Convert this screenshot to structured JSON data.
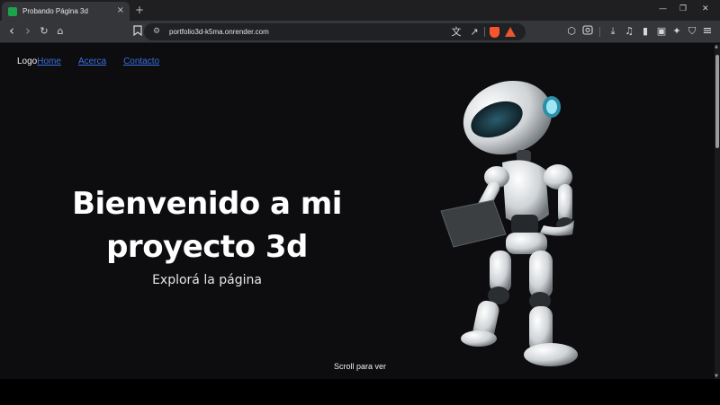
{
  "browser": {
    "tab_title": "Probando Página 3d",
    "tab_close": "×",
    "new_tab": "+",
    "url": "portfolio3d-k5ma.onrender.com",
    "window_controls": {
      "minimize": "—",
      "restore": "❐",
      "close": "✕"
    }
  },
  "toolbar_icons": {
    "back": "‹",
    "forward": "›",
    "reload": "↻",
    "home": "⌂",
    "translate": "文",
    "share": "↗",
    "extensions": "⬡",
    "download": "⤓",
    "media": "♫",
    "sidebar": "▮",
    "wallet": "▣",
    "leo": "✦",
    "vpn": "⛉",
    "menu": "≡"
  },
  "nav": {
    "logo": "Logo",
    "links": [
      "Home",
      "Acerca",
      "Contacto"
    ]
  },
  "hero": {
    "title_line1": "Bienvenido a mi",
    "title_line2": "proyecto 3d",
    "subtitle": "Explorá la página"
  },
  "scroll_hint": "Scroll para ver",
  "colors": {
    "page_bg": "#0d0d10",
    "link": "#3b6fe0",
    "favicon": "#1aa34a",
    "robot_visor_glow": "#3fb7d4"
  }
}
